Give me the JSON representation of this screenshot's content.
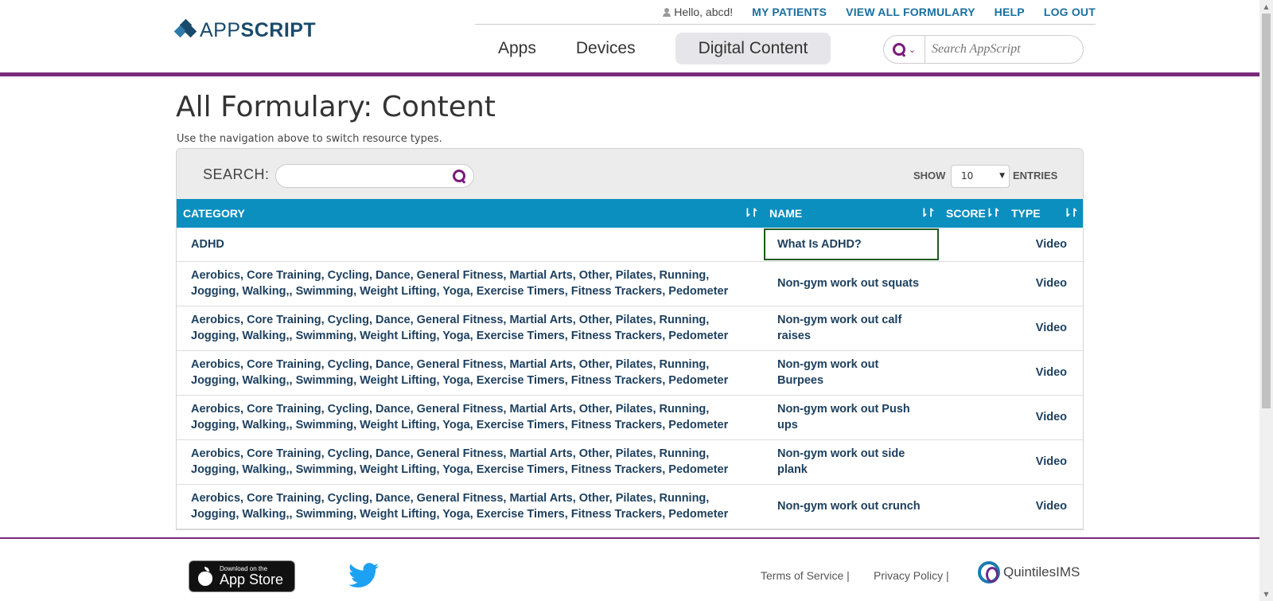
{
  "header": {
    "logo": {
      "light": "APP",
      "bold": "SCRIPT"
    },
    "greeting": "Hello, abcd!",
    "links": [
      "MY PATIENTS",
      "VIEW ALL FORMULARY",
      "HELP",
      "LOG OUT"
    ],
    "nav": [
      "Apps",
      "Devices",
      "Digital Content"
    ],
    "active_nav": "Digital Content",
    "search_placeholder": "Search AppScript",
    "accent_color": "#7a2a7a"
  },
  "main": {
    "title": "All Formulary: Content",
    "subtitle": "Use the navigation above to switch resource types.",
    "filter": {
      "search_label": "SEARCH:",
      "show_label": "SHOW",
      "show_value": "10",
      "entries_label": "ENTRIES"
    },
    "table": {
      "columns": [
        "CATEGORY",
        "NAME",
        "SCORE",
        "TYPE"
      ],
      "header_color": "#0a8fbf",
      "rows": [
        {
          "category": "ADHD",
          "name": "What Is ADHD?",
          "score": "",
          "type": "Video"
        },
        {
          "category": "Aerobics, Core Training, Cycling, Dance, General Fitness, Martial Arts, Other, Pilates, Running, Jogging, Walking,, Swimming, Weight Lifting, Yoga, Exercise Timers, Fitness Trackers, Pedometer",
          "name": "Non-gym work out squats",
          "score": "",
          "type": "Video"
        },
        {
          "category": "Aerobics, Core Training, Cycling, Dance, General Fitness, Martial Arts, Other, Pilates, Running, Jogging, Walking,, Swimming, Weight Lifting, Yoga, Exercise Timers, Fitness Trackers, Pedometer",
          "name": "Non-gym work out calf raises",
          "score": "",
          "type": "Video"
        },
        {
          "category": "Aerobics, Core Training, Cycling, Dance, General Fitness, Martial Arts, Other, Pilates, Running, Jogging, Walking,, Swimming, Weight Lifting, Yoga, Exercise Timers, Fitness Trackers, Pedometer",
          "name": "Non-gym work out Burpees",
          "score": "",
          "type": "Video"
        },
        {
          "category": "Aerobics, Core Training, Cycling, Dance, General Fitness, Martial Arts, Other, Pilates, Running, Jogging, Walking,, Swimming, Weight Lifting, Yoga, Exercise Timers, Fitness Trackers, Pedometer",
          "name": "Non-gym work out Push ups",
          "score": "",
          "type": "Video"
        },
        {
          "category": "Aerobics, Core Training, Cycling, Dance, General Fitness, Martial Arts, Other, Pilates, Running, Jogging, Walking,, Swimming, Weight Lifting, Yoga, Exercise Timers, Fitness Trackers, Pedometer",
          "name": "Non-gym work out side plank",
          "score": "",
          "type": "Video"
        },
        {
          "category": "Aerobics, Core Training, Cycling, Dance, General Fitness, Martial Arts, Other, Pilates, Running, Jogging, Walking,, Swimming, Weight Lifting, Yoga, Exercise Timers, Fitness Trackers, Pedometer",
          "name": "Non-gym work out crunch",
          "score": "",
          "type": "Video"
        }
      ]
    }
  },
  "footer": {
    "appstore_small": "Download on the",
    "appstore_big": "App Store",
    "terms": "Terms of Service |",
    "privacy": "Privacy Policy |",
    "partner": "QuintilesIMS"
  }
}
